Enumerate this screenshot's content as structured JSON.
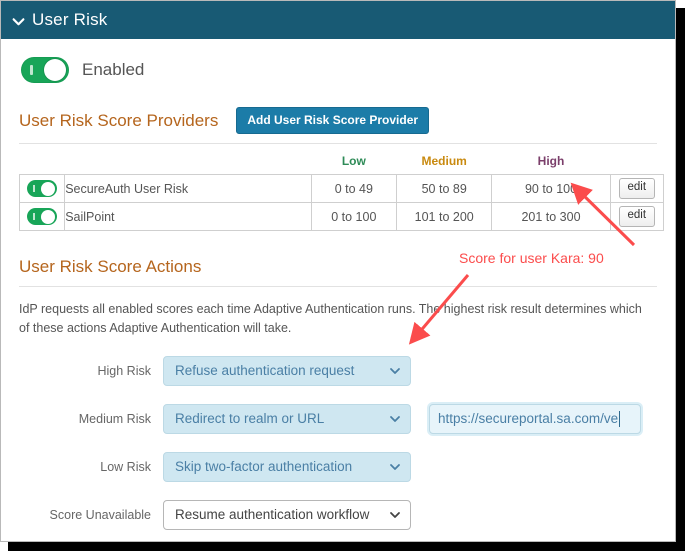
{
  "window": {
    "header": {
      "title": "User Risk",
      "chevron_icon": "chevron-down-icon"
    }
  },
  "enabled_toggle": {
    "label": "Enabled",
    "state": "on",
    "color": "#18a558"
  },
  "providers_section": {
    "title": "User Risk Score Providers",
    "add_button_label": "Add User Risk Score Provider",
    "add_button_color": "#1c7ca8",
    "columns": [
      "",
      "",
      "Low",
      "Medium",
      "High",
      ""
    ],
    "column_colors": {
      "low": "#2e8b57",
      "medium": "#c98a10",
      "high": "#7b3f6b"
    },
    "rows": [
      {
        "enabled": "on",
        "name": "SecureAuth User Risk",
        "low": "0 to 49",
        "medium": "50 to 89",
        "high": "90 to 100",
        "edit_label": "edit"
      },
      {
        "enabled": "on",
        "name": "SailPoint",
        "low": "0 to 100",
        "medium": "101 to 200",
        "high": "201 to 300",
        "edit_label": "edit"
      }
    ]
  },
  "actions_section": {
    "title": "User Risk Score Actions",
    "description": "IdP requests all enabled scores each time Adaptive Authentication runs. The highest risk result determines which of these actions Adaptive Authentication will take.",
    "fields": [
      {
        "label": "High Risk",
        "value": "Refuse authentication request",
        "highlighted": true,
        "caret_icon": "chevron-down-icon"
      },
      {
        "label": "Medium Risk",
        "value": "Redirect to realm or URL",
        "highlighted": true,
        "caret_icon": "chevron-down-icon"
      },
      {
        "label": "Low Risk",
        "value": "Skip two-factor authentication",
        "highlighted": true,
        "caret_icon": "chevron-down-icon"
      },
      {
        "label": "Score Unavailable",
        "value": "Resume authentication workflow",
        "highlighted": false,
        "caret_icon": "chevron-down-icon"
      }
    ],
    "url_field": {
      "value": "https://secureportal.sa.com/ve",
      "placeholder": "https://"
    }
  },
  "annotations": {
    "color": "#fb4c4c",
    "note": "Score for user Kara: 90"
  }
}
